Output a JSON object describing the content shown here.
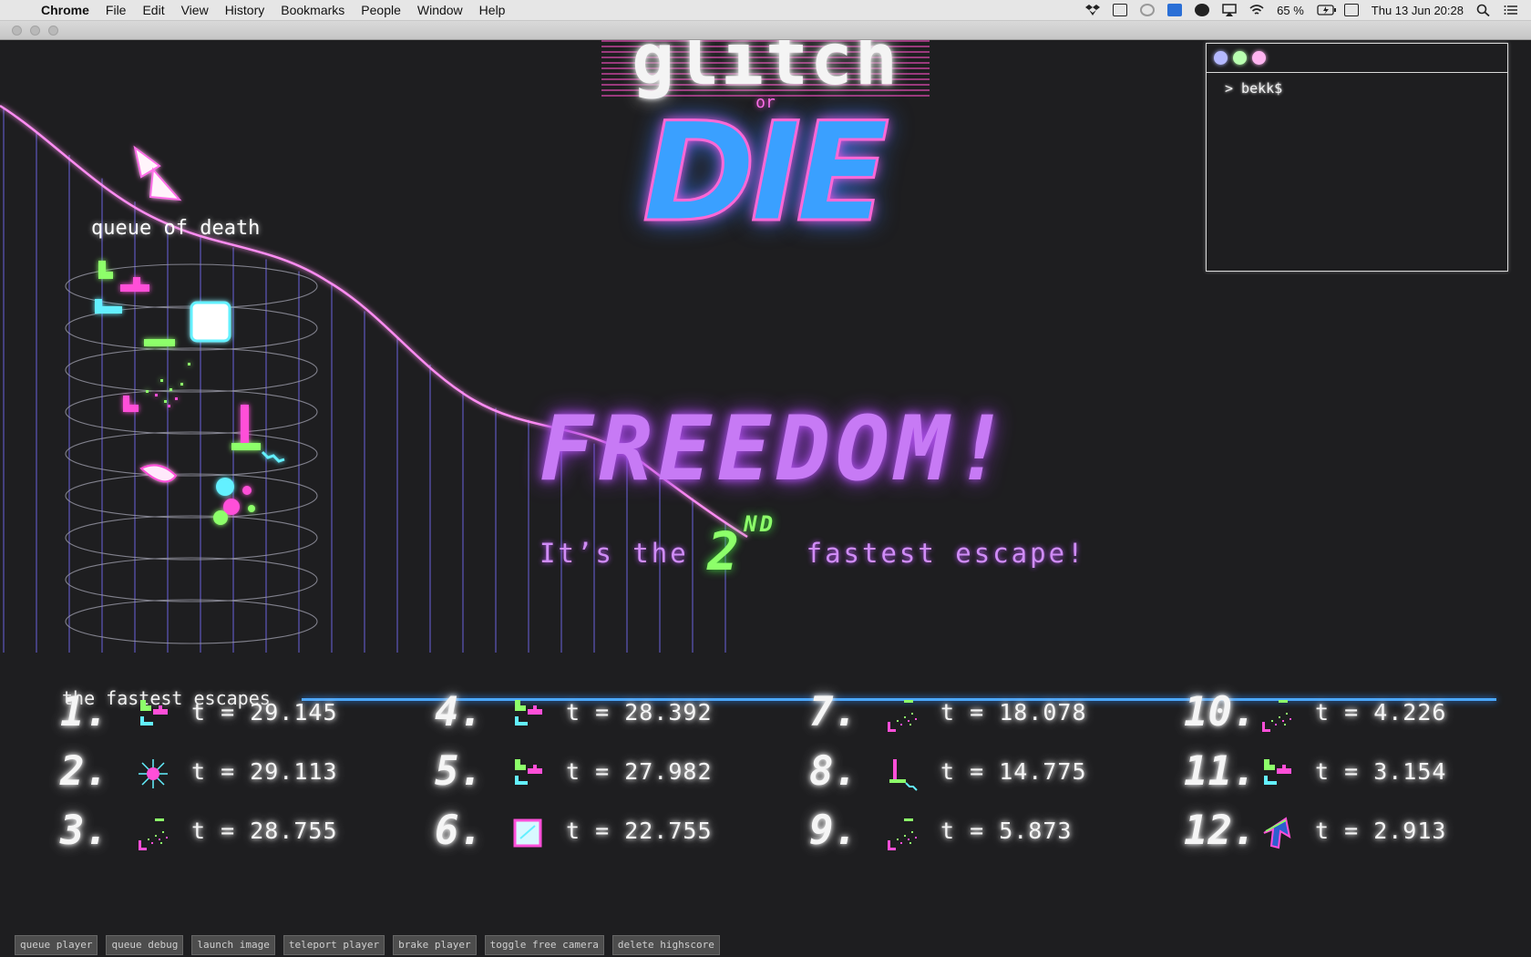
{
  "menubar": {
    "app_name": "Chrome",
    "items": [
      "File",
      "Edit",
      "View",
      "History",
      "Bookmarks",
      "People",
      "Window",
      "Help"
    ],
    "battery": "65 %",
    "clock": "Thu 13 Jun  20:28"
  },
  "game": {
    "logo_top": "glitch",
    "logo_or": "or",
    "logo_main": "DIE",
    "queue_label": "queue of death",
    "headline": "FREEDOM!",
    "escape_prefix": "It’s the",
    "escape_rank": "2",
    "escape_rank_suffix": "ND",
    "escape_suffix": "fastest escape!"
  },
  "terminal": {
    "prompt": "> bekk$",
    "dot_colors": [
      "#b4b8ff",
      "#b9ffb0",
      "#ffb4f0"
    ]
  },
  "scoreboard": {
    "title": "the fastest escapes",
    "entries": [
      {
        "rank": "1.",
        "time": "t = 29.145",
        "icon": "blocks-icon"
      },
      {
        "rank": "2.",
        "time": "t = 29.113",
        "icon": "spark-icon"
      },
      {
        "rank": "3.",
        "time": "t = 28.755",
        "icon": "debris-icon"
      },
      {
        "rank": "4.",
        "time": "t = 28.392",
        "icon": "blocks-icon"
      },
      {
        "rank": "5.",
        "time": "t = 27.982",
        "icon": "blocks-icon"
      },
      {
        "rank": "6.",
        "time": "t = 22.755",
        "icon": "image-icon"
      },
      {
        "rank": "7.",
        "time": "t = 18.078",
        "icon": "debris-icon"
      },
      {
        "rank": "8.",
        "time": "t = 14.775",
        "icon": "corner-icon"
      },
      {
        "rank": "9.",
        "time": "t = 5.873",
        "icon": "debris-icon"
      },
      {
        "rank": "10.",
        "time": "t = 4.226",
        "icon": "debris-icon"
      },
      {
        "rank": "11.",
        "time": "t = 3.154",
        "icon": "blocks-icon"
      },
      {
        "rank": "12.",
        "time": "t = 2.913",
        "icon": "arrow-icon"
      }
    ]
  },
  "debug_buttons": [
    "queue player",
    "queue debug",
    "launch image",
    "teleport player",
    "brake player",
    "toggle free camera",
    "delete highscore"
  ],
  "colors": {
    "neon_pink": "#ff6ee8",
    "neon_green": "#8dff6a",
    "neon_cyan": "#63f0ff",
    "neon_purple": "#c77af5",
    "neon_blue": "#4ba8ff"
  }
}
